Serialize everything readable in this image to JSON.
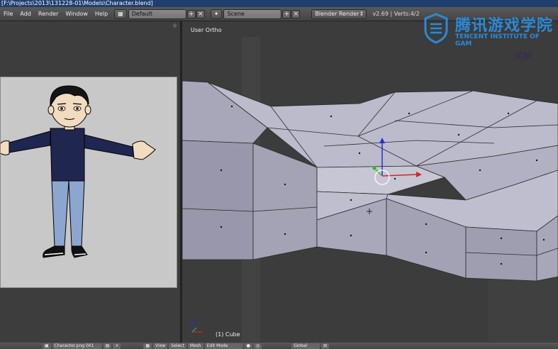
{
  "title_bar": {
    "path": "[F:\\Projects\\2013\\131228-01\\Models\\Character.blend]"
  },
  "menu": {
    "items": [
      "File",
      "Add",
      "Render",
      "Window",
      "Help"
    ]
  },
  "header": {
    "screen_layout": "Default",
    "scene": "Scene",
    "render_engine": "Blender Render",
    "stats": "v2.69 | Verts:4/2"
  },
  "viewport": {
    "view_name": "User Ortho",
    "active_object": "(1) Cube"
  },
  "bottom_bar": {
    "image_name": "Character.png 001",
    "view_menu": "View",
    "select_menu": "Select",
    "mesh_menu": "Mesh",
    "mode": "Edit Mode",
    "orientation": "Global"
  },
  "watermark": {
    "title": "腾讯游戏学院",
    "subtitle": "TENCENT INSTITUTE OF GAM",
    "signature": "成都"
  },
  "colors": {
    "accent": "#2a8ad8",
    "mesh_face": "#b8b6c8",
    "axis_z": "#2030e0",
    "axis_x": "#e02020",
    "axis_y": "#20c020"
  }
}
